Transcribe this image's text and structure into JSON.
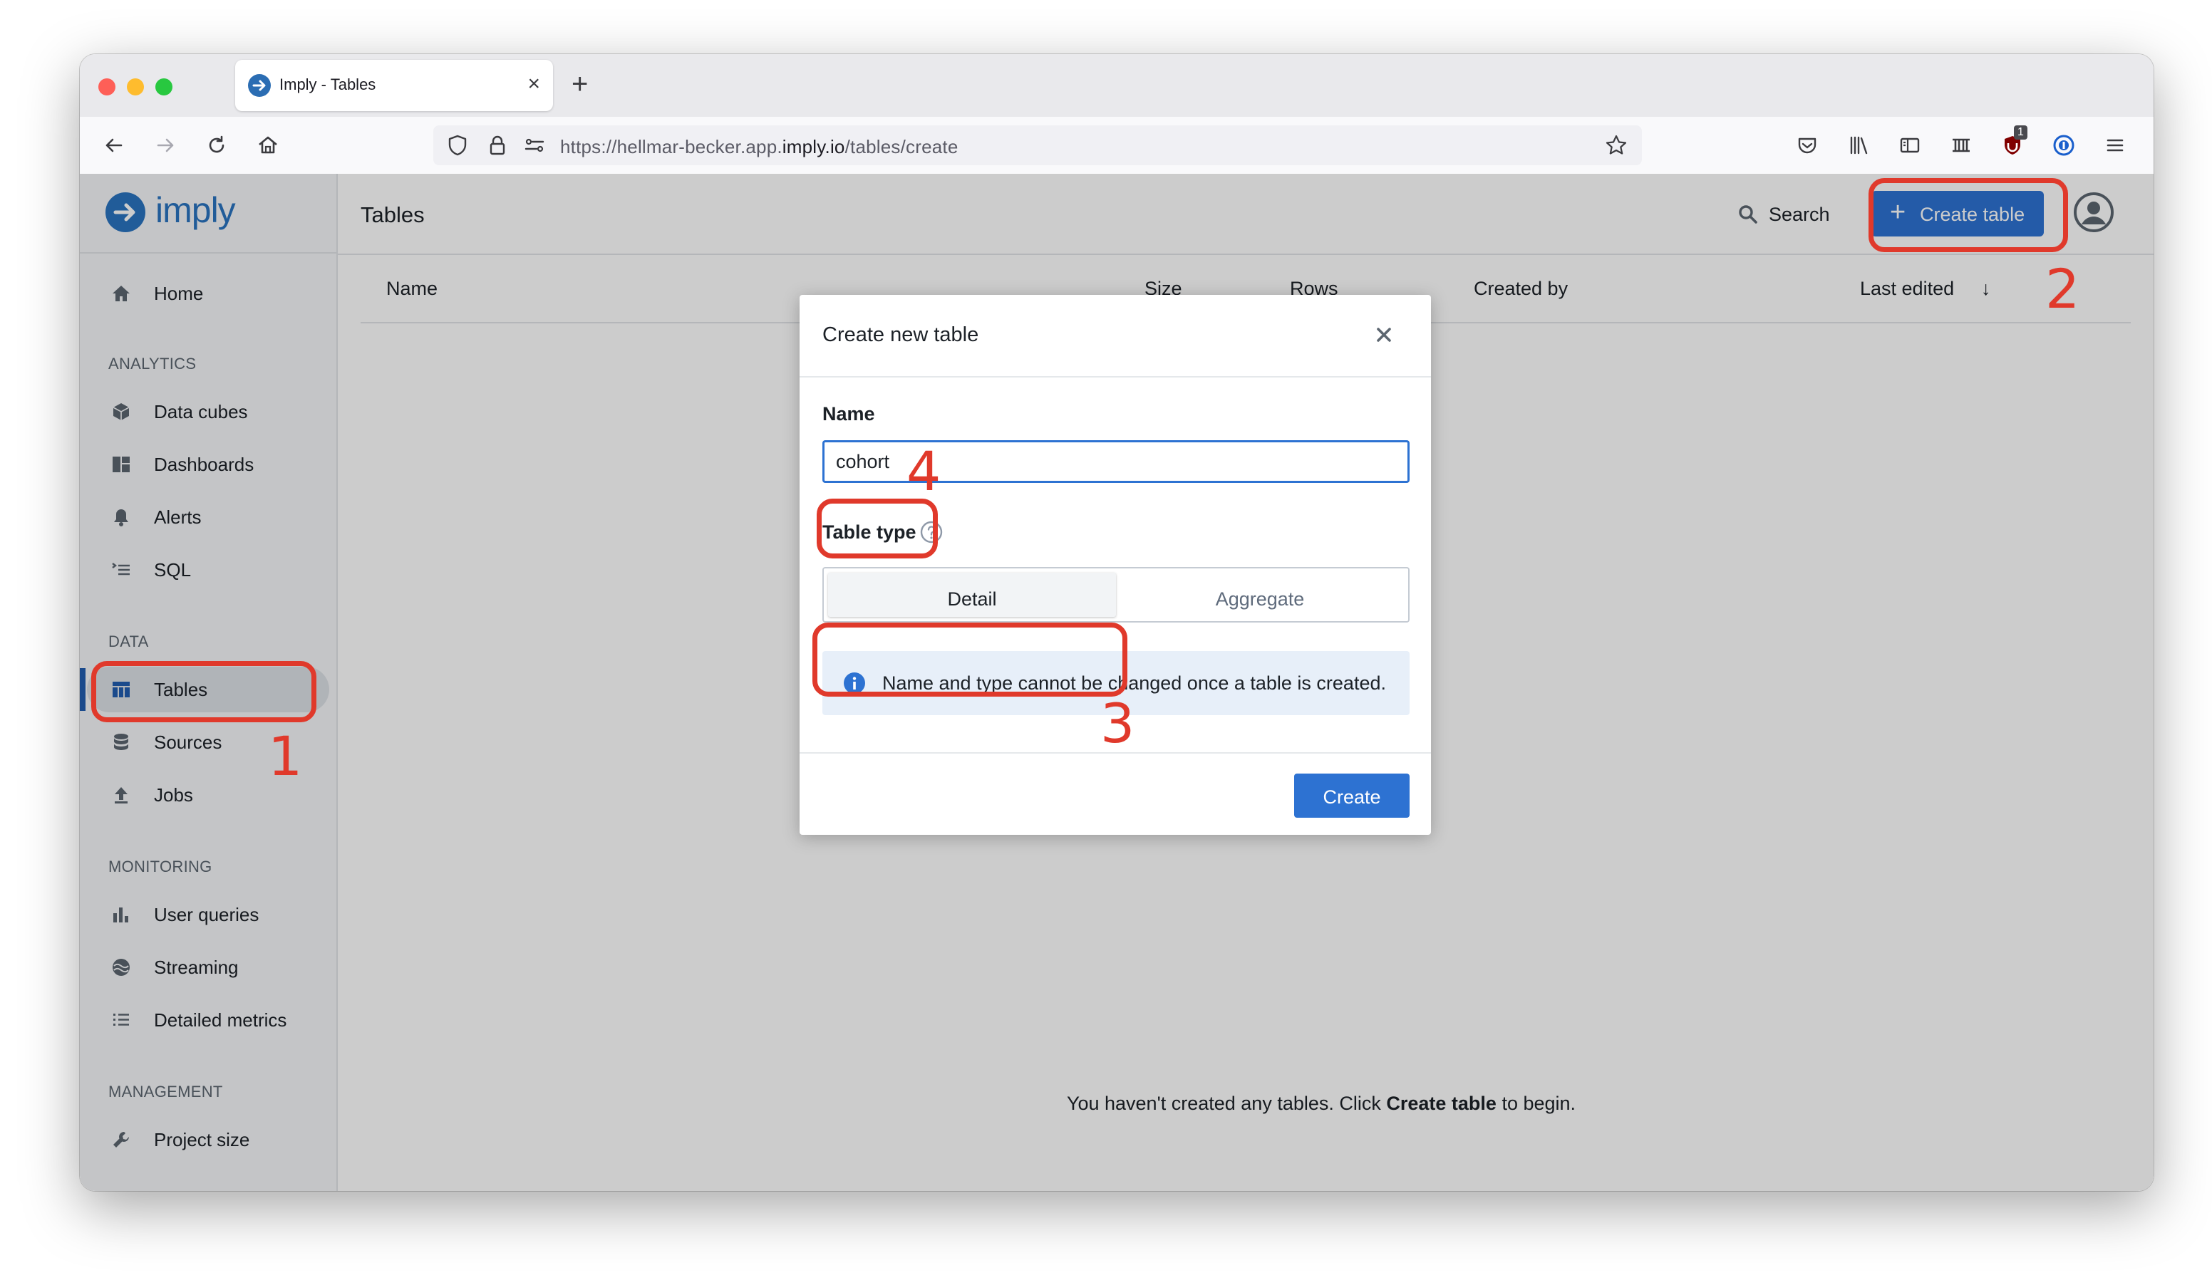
{
  "browser": {
    "tab_title": "Imply - Tables",
    "url_prefix": "https://hellmar-becker.app.",
    "url_host": "imply.io",
    "url_path": "/tables/create",
    "extension_badge": "1"
  },
  "app": {
    "logo_text": "imply",
    "page_title": "Tables",
    "search_label": "Search",
    "create_table_label": "Create table"
  },
  "sidebar": {
    "home": "Home",
    "sections": {
      "analytics": "ANALYTICS",
      "data": "DATA",
      "monitoring": "MONITORING",
      "management": "MANAGEMENT"
    },
    "items": {
      "data_cubes": "Data cubes",
      "dashboards": "Dashboards",
      "alerts": "Alerts",
      "sql": "SQL",
      "tables": "Tables",
      "sources": "Sources",
      "jobs": "Jobs",
      "user_queries": "User queries",
      "streaming": "Streaming",
      "detailed_metrics": "Detailed metrics",
      "project_size": "Project size"
    }
  },
  "table": {
    "columns": [
      "Name",
      "Size",
      "Rows",
      "Created by",
      "Last edited"
    ],
    "sort_indicator": "↓",
    "empty_prefix": "You haven't created any tables. Click ",
    "empty_bold": "Create table",
    "empty_suffix": " to begin."
  },
  "dialog": {
    "title": "Create new table",
    "name_label": "Name",
    "name_value": "cohort",
    "table_type_label": "Table type",
    "type_detail": "Detail",
    "type_aggregate": "Aggregate",
    "selected_type": "Detail",
    "info_text": "Name and type cannot be changed once a table is created.",
    "create_label": "Create"
  },
  "annotations": {
    "step_1": "1",
    "step_2": "2",
    "step_3": "3",
    "step_4": "4",
    "color": "#e0392b"
  },
  "colors": {
    "primary": "#2d72d2",
    "brand": "#2a74c0",
    "sidebar_bg": "#f6f7f9"
  }
}
